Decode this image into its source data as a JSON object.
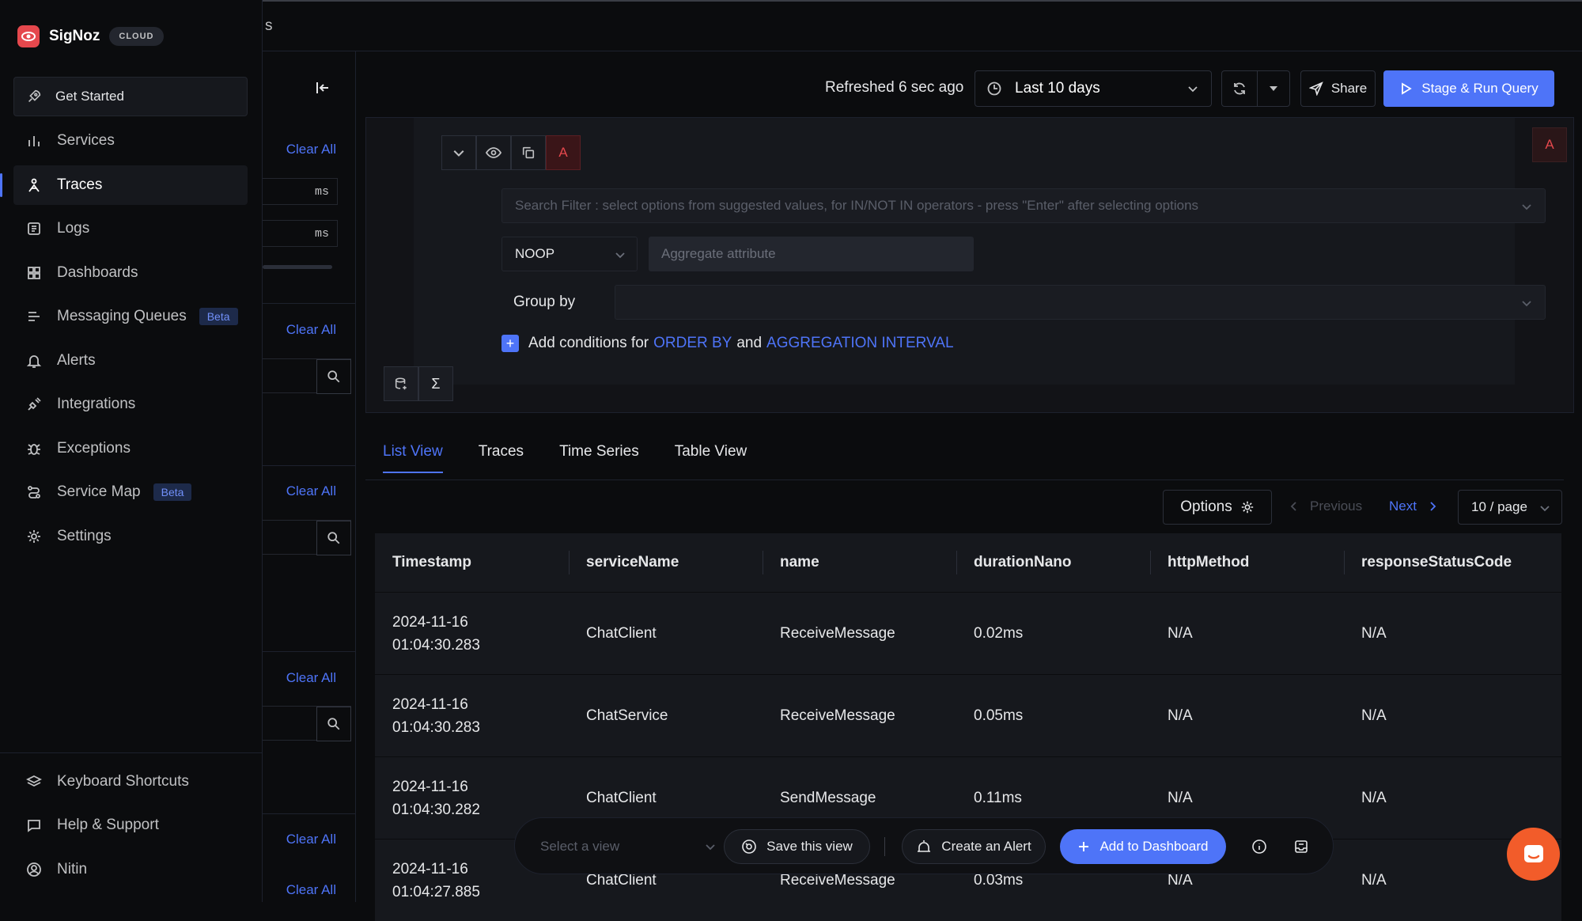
{
  "app": {
    "name": "SigNoz",
    "badge": "CLOUD",
    "breadcrumb_fragment": "s"
  },
  "sidebar": {
    "get_started": "Get Started",
    "items": [
      {
        "label": "Services"
      },
      {
        "label": "Traces"
      },
      {
        "label": "Logs"
      },
      {
        "label": "Dashboards"
      },
      {
        "label": "Messaging Queues",
        "badge": "Beta"
      },
      {
        "label": "Alerts"
      },
      {
        "label": "Integrations"
      },
      {
        "label": "Exceptions"
      },
      {
        "label": "Service Map",
        "badge": "Beta"
      },
      {
        "label": "Settings"
      }
    ],
    "bottom": [
      {
        "label": "Keyboard Shortcuts"
      },
      {
        "label": "Help & Support"
      },
      {
        "label": "Nitin"
      }
    ]
  },
  "filter_panel": {
    "clear_all": "Clear All",
    "ms_unit": "ms"
  },
  "header": {
    "refreshed": "Refreshed 6 sec ago",
    "time_range": "Last 10 days",
    "share": "Share",
    "run": "Stage & Run Query"
  },
  "query": {
    "name": "A",
    "search_placeholder": "Search Filter : select options from suggested values, for IN/NOT IN operators - press \"Enter\" after selecting options",
    "aggregate_op": "NOOP",
    "aggregate_placeholder": "Aggregate attribute",
    "group_by_label": "Group by",
    "add_conditions_prefix": "Add conditions for",
    "order_by": "ORDER BY",
    "and": "and",
    "aggregation_interval": "AGGREGATION INTERVAL",
    "sigma": "Σ"
  },
  "tabs": [
    {
      "label": "List View",
      "active": true
    },
    {
      "label": "Traces"
    },
    {
      "label": "Time Series"
    },
    {
      "label": "Table View"
    }
  ],
  "pagination": {
    "options": "Options",
    "previous": "Previous",
    "next": "Next",
    "page_size": "10 / page"
  },
  "table": {
    "columns": [
      "Timestamp",
      "serviceName",
      "name",
      "durationNano",
      "httpMethod",
      "responseStatusCode"
    ],
    "rows": [
      {
        "date": "2024-11-16",
        "time": "01:04:30.283",
        "service": "ChatClient",
        "name": "ReceiveMessage",
        "duration": "0.02ms",
        "method": "N/A",
        "status": "N/A"
      },
      {
        "date": "2024-11-16",
        "time": "01:04:30.283",
        "service": "ChatService",
        "name": "ReceiveMessage",
        "duration": "0.05ms",
        "method": "N/A",
        "status": "N/A"
      },
      {
        "date": "2024-11-16",
        "time": "01:04:30.282",
        "service": "ChatClient",
        "name": "SendMessage",
        "duration": "0.11ms",
        "method": "N/A",
        "status": "N/A"
      },
      {
        "date": "2024-11-16",
        "time": "01:04:27.885",
        "service": "ChatClient",
        "name": "ReceiveMessage",
        "duration": "0.03ms",
        "method": "N/A",
        "status": "N/A"
      }
    ]
  },
  "bottom_bar": {
    "select_view_placeholder": "Select a view",
    "save_view": "Save this view",
    "create_alert": "Create an Alert",
    "add_to_dashboard": "Add to Dashboard"
  },
  "colors": {
    "accent": "#4e74f8",
    "brand": "#e5484d",
    "background": "#0b0c0e",
    "chat_fab": "#f25c2a"
  }
}
